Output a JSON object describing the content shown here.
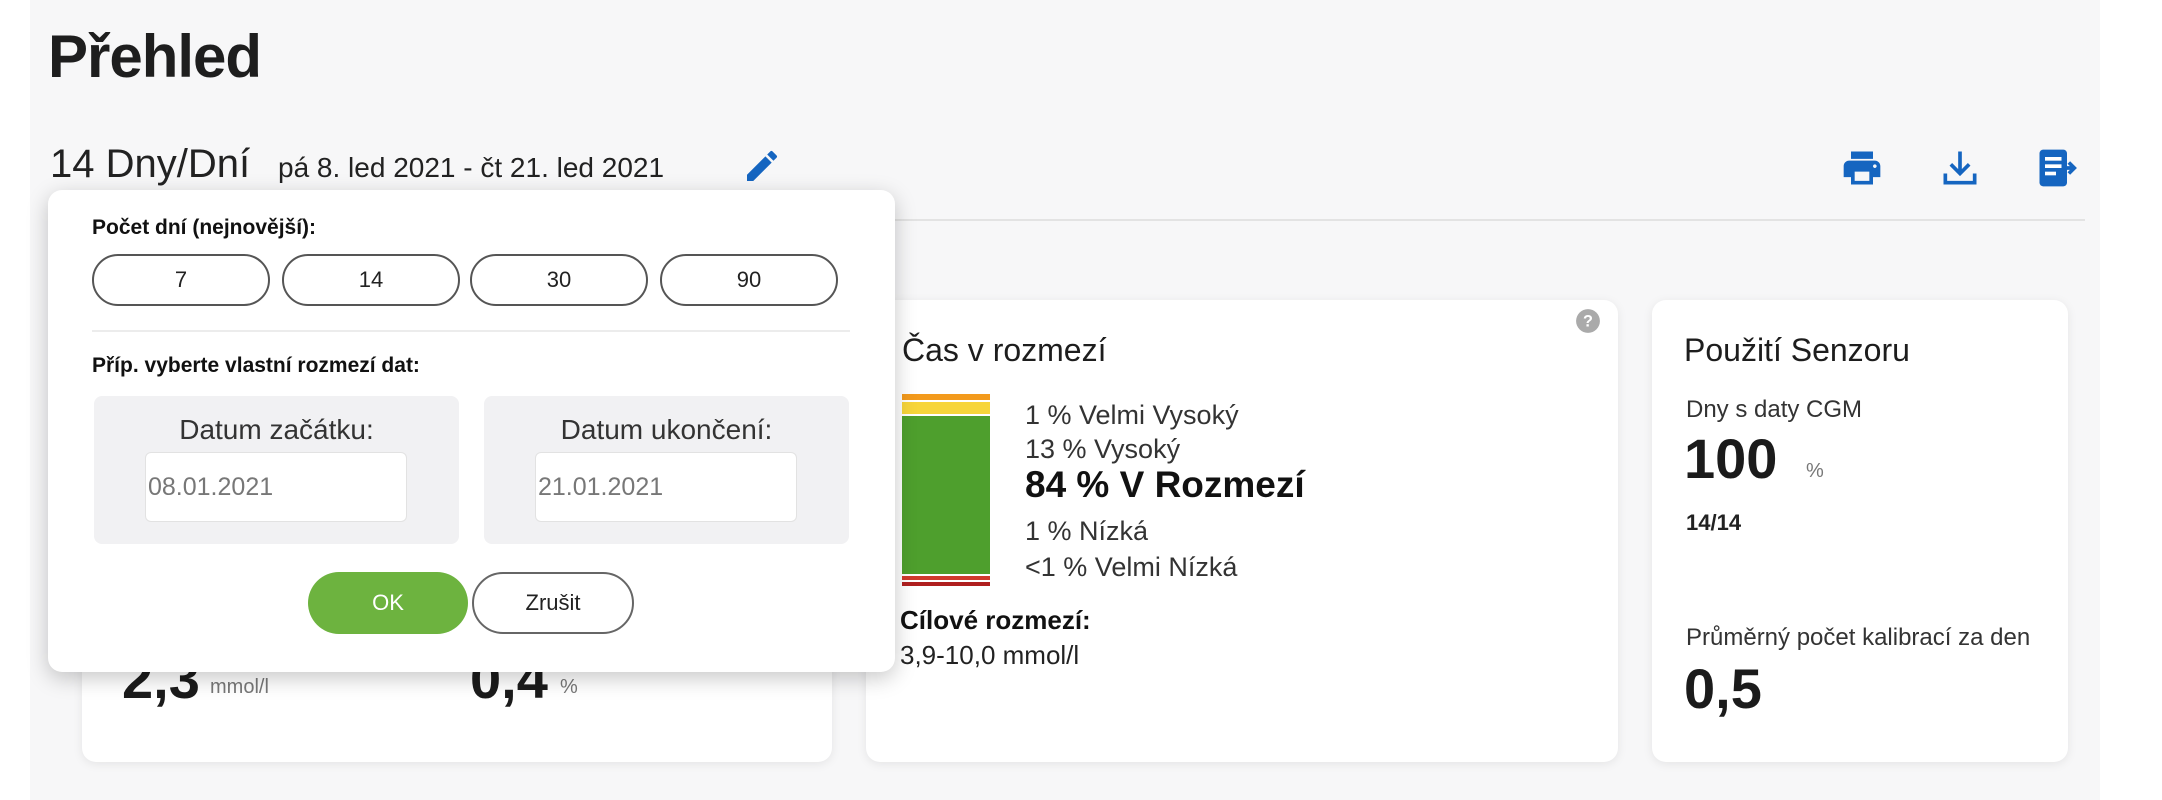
{
  "page": {
    "title": "Přehled"
  },
  "range": {
    "days_label": "14 Dny/Dní",
    "dates": "pá 8. led 2021 - čt 21. led 2021"
  },
  "toolbar": {
    "edit_icon": "pencil-icon",
    "print_icon": "printer-icon",
    "download_icon": "download-icon",
    "export_icon": "export-icon"
  },
  "glucose_card": {
    "avg_value": "2,3",
    "avg_unit": "mmol/l",
    "gmi_value": "0,4",
    "gmi_unit": "%"
  },
  "time_in_range": {
    "title": "Čas v rozmezí",
    "rows": {
      "very_high": "1 % Velmi Vysoký",
      "high": "13 % Vysoký",
      "in_range": "84 % V Rozmezí",
      "low": "1 % Nízká",
      "very_low": "<1 % Velmi Nízká"
    },
    "bar_percentages": {
      "very_high": 1,
      "high": 13,
      "in_range": 84,
      "low": 1,
      "very_low": 1
    },
    "bar_colors": {
      "very_high": "#f39a1c",
      "high": "#f7d53b",
      "in_range": "#4e9f2d",
      "low": "#d13a2e",
      "very_low": "#b02020"
    },
    "target_label": "Cílové rozmezí:",
    "target_value": "3,9-10,0 mmol/l"
  },
  "sensor": {
    "title": "Použití Senzoru",
    "cgm_days_label": "Dny s daty CGM",
    "cgm_percent": "100",
    "cgm_percent_unit": "%",
    "cgm_ratio": "14/14",
    "calib_label": "Průměrný počet kalibrací za den",
    "calib_value": "0,5"
  },
  "popup": {
    "days_label": "Počet dní (nejnovější):",
    "day_options": [
      "7",
      "14",
      "30",
      "90"
    ],
    "custom_label": "Příp. vyberte vlastní rozmezí dat:",
    "start_label": "Datum začátku:",
    "start_value": "08.01.2021",
    "end_label": "Datum ukončení:",
    "end_value": "21.01.2021",
    "ok_label": "OK",
    "cancel_label": "Zrušit"
  },
  "colors": {
    "accent": "#1565c0",
    "ok_green": "#6db33f"
  }
}
